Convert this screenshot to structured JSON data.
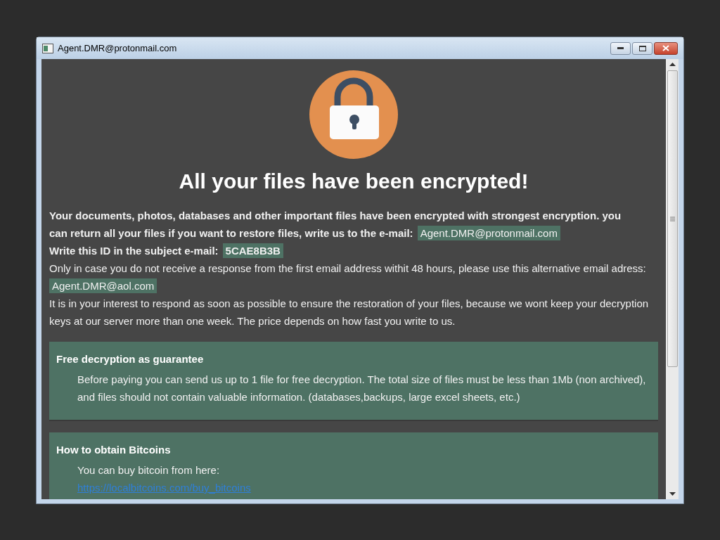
{
  "window": {
    "title": "Agent.DMR@protonmail.com"
  },
  "heading": "All your files have been encrypted!",
  "paragraphs": [
    {
      "segments": [
        {
          "kind": "bold",
          "text": "Your documents, photos, databases and other important files have been encrypted with strongest encryption. you"
        }
      ]
    },
    {
      "segments": [
        {
          "kind": "bold",
          "text": "can return all your files if you want to restore files, write us to the e-mail:"
        },
        {
          "kind": "email",
          "text": "Agent.DMR@protonmail.com"
        }
      ]
    },
    {
      "segments": [
        {
          "kind": "bold",
          "text": "Write this ID in the subject e-mail:"
        },
        {
          "kind": "id",
          "text": "5CAE8B3B"
        }
      ]
    },
    {
      "segments": [
        {
          "kind": "plain",
          "text": "Only in case you do not receive a response from the first email address withit 48 hours, please use this alternative email adress:"
        },
        {
          "kind": "email",
          "text": "Agent.DMR@aol.com"
        }
      ]
    },
    {
      "segments": [
        {
          "kind": "plain",
          "text": "It is in your interest to respond as soon as possible to ensure the restoration of your files, because we wont keep your decryption keys at our server more than one week. The price depends on how fast you write to us."
        }
      ]
    }
  ],
  "sections": [
    {
      "title": "Free decryption as guarantee",
      "body": [
        {
          "kind": "text",
          "text": "Before paying you can send us up to 1 file for free decryption. The total size of files must be less than 1Mb (non archived), and files should not contain valuable information. (databases,backups, large excel sheets, etc.)"
        }
      ]
    },
    {
      "title": "How to obtain Bitcoins",
      "body": [
        {
          "kind": "text",
          "text": "You can buy bitcoin from here:"
        },
        {
          "kind": "link",
          "text": "https://localbitcoins.com/buy_bitcoins"
        }
      ]
    }
  ]
}
